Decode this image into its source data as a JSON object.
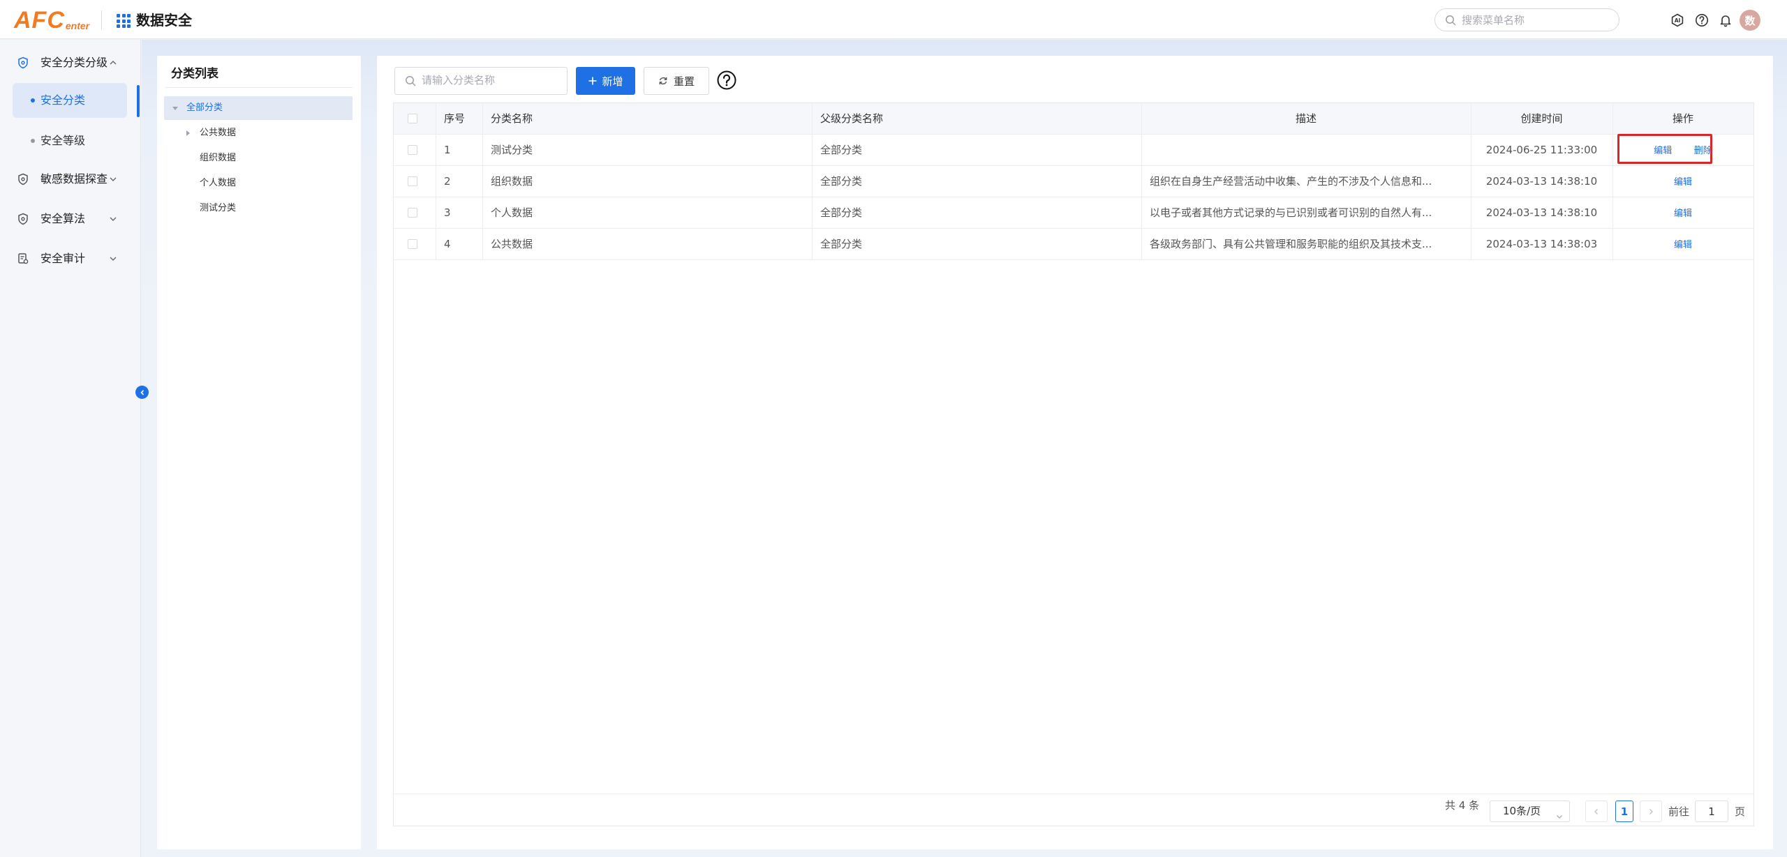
{
  "header": {
    "logo_main": "AFC",
    "logo_sub": "enter",
    "app_title": "数据安全",
    "search_placeholder": "搜索菜单名称",
    "avatar_text": "数"
  },
  "sidebar": {
    "groups": [
      {
        "label": "安全分类分级",
        "icon": "shield-icon",
        "expanded": true
      },
      {
        "label": "敏感数据探查",
        "icon": "shield-icon",
        "expanded": false
      },
      {
        "label": "安全算法",
        "icon": "shield-icon",
        "expanded": false
      },
      {
        "label": "安全审计",
        "icon": "audit-icon",
        "expanded": false
      }
    ],
    "sub_items": [
      {
        "label": "安全分类",
        "active": true
      },
      {
        "label": "安全等级",
        "active": false
      }
    ]
  },
  "tree": {
    "title": "分类列表",
    "nodes": [
      {
        "label": "全部分类",
        "selected": true
      },
      {
        "label": "公共数据"
      },
      {
        "label": "组织数据"
      },
      {
        "label": "个人数据"
      },
      {
        "label": "测试分类"
      }
    ]
  },
  "toolbar": {
    "search_placeholder": "请输入分类名称",
    "add_label": "新增",
    "reset_label": "重置"
  },
  "table": {
    "columns": [
      "序号",
      "分类名称",
      "父级分类名称",
      "描述",
      "创建时间",
      "操作"
    ],
    "rows": [
      {
        "index": "1",
        "name": "测试分类",
        "parent": "全部分类",
        "desc": "",
        "created": "2024-06-25 11:33:00",
        "ops": [
          "编辑",
          "删除"
        ]
      },
      {
        "index": "2",
        "name": "组织数据",
        "parent": "全部分类",
        "desc": "组织在自身生产经营活动中收集、产生的不涉及个人信息和...",
        "created": "2024-03-13 14:38:10",
        "ops": [
          "编辑"
        ]
      },
      {
        "index": "3",
        "name": "个人数据",
        "parent": "全部分类",
        "desc": "以电子或者其他方式记录的与已识别或者可识别的自然人有...",
        "created": "2024-03-13 14:38:10",
        "ops": [
          "编辑"
        ]
      },
      {
        "index": "4",
        "name": "公共数据",
        "parent": "全部分类",
        "desc": "各级政务部门、具有公共管理和服务职能的组织及其技术支...",
        "created": "2024-03-13 14:38:03",
        "ops": [
          "编辑"
        ]
      }
    ]
  },
  "pagination": {
    "total": "共 4 条",
    "page_size": "10条/页",
    "current": "1",
    "goto_label": "前往",
    "goto_value": "1",
    "page_suffix": "页"
  },
  "colors": {
    "primary": "#1f6fe5",
    "logo": "#f47a1f",
    "highlight": "#d9262a"
  }
}
